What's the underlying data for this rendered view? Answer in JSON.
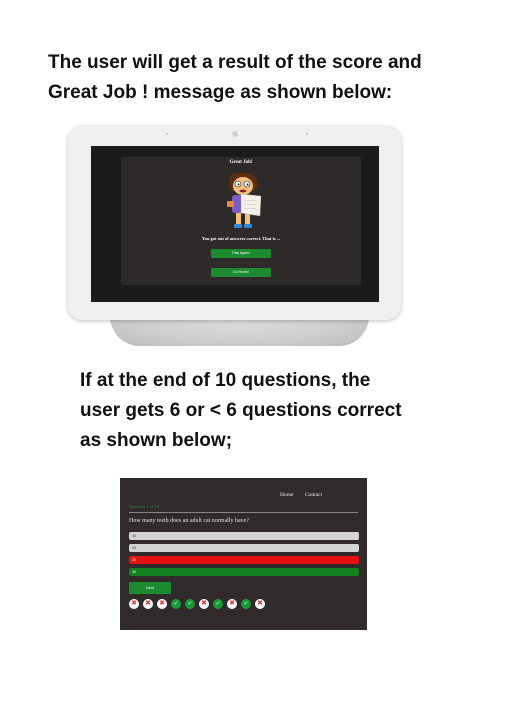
{
  "top_text": {
    "line1": "The user will get a result of the score and",
    "line2": "Great Job ! message as shown below:"
  },
  "result_screen": {
    "title": "Great Job!",
    "result_text": "You got   out of     answers correct. That is ...",
    "play_again": "Play Again!",
    "go_home": "Go Home!",
    "character_icon": "cartoon-reading-person",
    "colors": {
      "button": "#1c8a2e",
      "card": "#2e2a29",
      "screen": "#1b1b1b"
    }
  },
  "middle_text": {
    "line1": "If  at the end of 10 questions, the",
    "line2": "user gets  6 or < 6 questions correct",
    "line3": "as shown below;"
  },
  "quiz_screen": {
    "nav": {
      "home": "Home",
      "contact": "Contact"
    },
    "question_count": "Question 1 of 10",
    "question": "How many teeth does an adult cat normally have?",
    "options": [
      {
        "label": "40",
        "state": "neutral",
        "color": "#d3d3d3"
      },
      {
        "label": "24",
        "state": "neutral",
        "color": "#d3d3d3"
      },
      {
        "label": "26",
        "state": "wrong",
        "color": "#e81111"
      },
      {
        "label": "30",
        "state": "correct",
        "color": "#12821f"
      }
    ],
    "next_button": "Next",
    "score_marks": [
      "wrong",
      "wrong",
      "wrong",
      "correct",
      "correct",
      "wrong",
      "correct",
      "wrong",
      "correct",
      "wrong"
    ]
  }
}
